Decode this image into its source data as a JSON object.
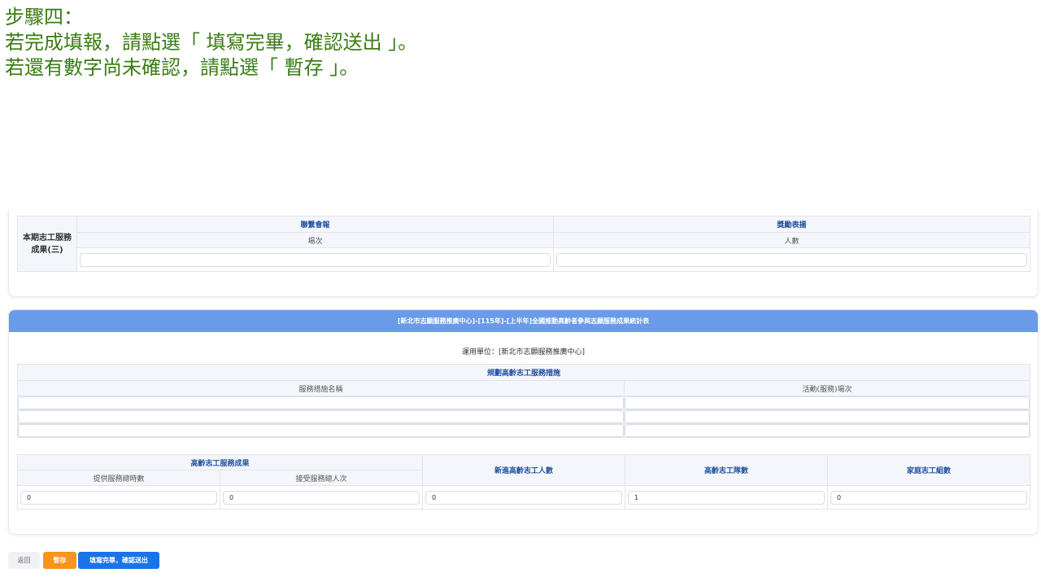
{
  "instructions": {
    "line1": "步驟四：",
    "line2": "若完成填報，請點選「 填寫完畢，確認送出 」。",
    "line3": "若還有數字尚未確認，請點選「 暫存 」。"
  },
  "section3": {
    "row_label": "本期志工服務成果(三)",
    "col1_group": "聯繫會報",
    "col1_sub": "場次",
    "col1_value": "",
    "col2_group": "獎勵表揚",
    "col2_sub": "人數",
    "col2_value": ""
  },
  "report": {
    "header": "[新北市志願服務推廣中心]-[115年]-[上半年]全國推動高齡者參與志願服務成果統計表",
    "unit_label": "運用單位：[新北市志願服務推廣中心]",
    "plan": {
      "title": "規劃高齡志工服務措施",
      "col_name": "服務措施名稱",
      "col_sessions": "活動(服務)場次",
      "rows": [
        {
          "name": "",
          "sessions": ""
        },
        {
          "name": "",
          "sessions": ""
        },
        {
          "name": "",
          "sessions": ""
        }
      ]
    },
    "results": {
      "group": "高齡志工服務成果",
      "hours": "提供服務總時數",
      "people": "接受服務總人次",
      "new_volunteers": "新進高齡志工人數",
      "teams": "高齡志工隊數",
      "family_groups": "家庭志工組數",
      "values": {
        "hours": "0",
        "people": "0",
        "new_volunteers": "0",
        "teams": "1",
        "family_groups": "0"
      }
    }
  },
  "buttons": {
    "back": "返回",
    "save": "暫存",
    "submit": "填寫完畢，確認送出"
  },
  "colors": {
    "instruction_text": "#3a7d14",
    "header_bar": "#6a9be8",
    "save_button": "#f7941d",
    "submit_button": "#1a73e8",
    "section_heading": "#1f4f9f"
  }
}
